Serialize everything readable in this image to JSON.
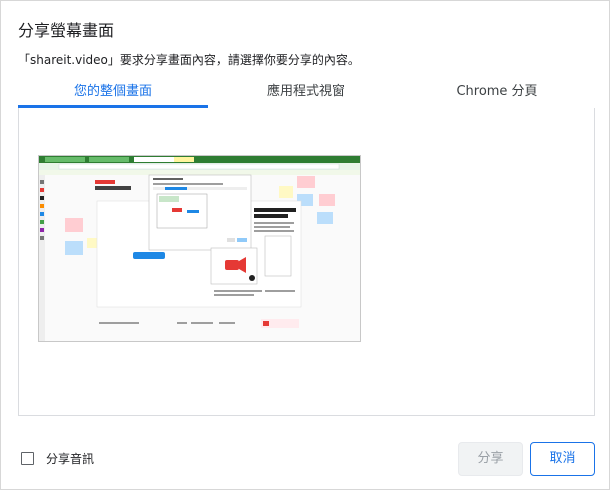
{
  "dialog": {
    "title": "分享螢幕畫面",
    "description": "「shareit.video」要求分享畫面內容，請選擇你要分享的內容。"
  },
  "tabs": [
    {
      "label": "您的整個畫面",
      "active": true
    },
    {
      "label": "應用程式視窗",
      "active": false
    },
    {
      "label": "Chrome 分頁",
      "active": false
    }
  ],
  "preview": {
    "thumbnail_icon": "screen-thumbnail"
  },
  "footer": {
    "audio_label": "分享音訊",
    "audio_checked": false,
    "share_label": "分享",
    "cancel_label": "取消"
  },
  "colors": {
    "accent": "#1a73e8",
    "disabled_bg": "#f1f3f4",
    "disabled_text": "#9aa0a6"
  }
}
